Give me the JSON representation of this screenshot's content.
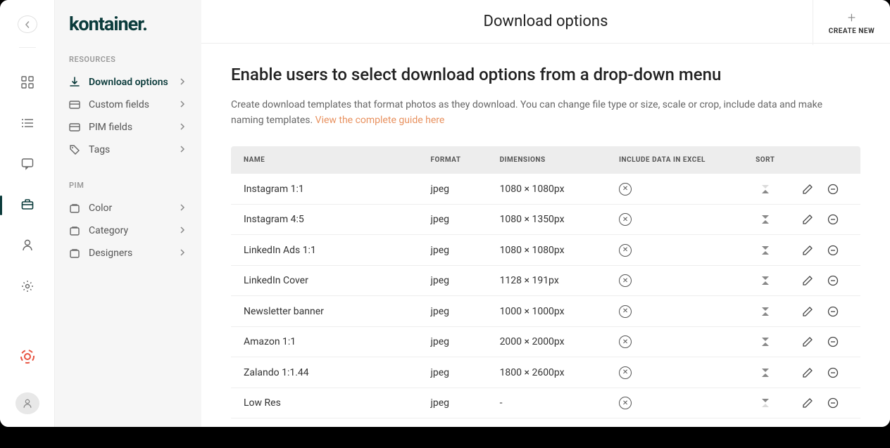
{
  "logo": "kontainer.",
  "page_title": "Download options",
  "create_new_label": "CREATE NEW",
  "heading": "Enable users to select download options from a drop-down menu",
  "description": "Create download templates that format photos as they download. You can change file type or size, scale or crop, include data and make naming templates. ",
  "description_link": "View the complete guide here",
  "sidebar": {
    "section1_label": "RESOURCES",
    "section2_label": "PIM",
    "items1": [
      {
        "label": "Download options",
        "icon": "download",
        "active": true
      },
      {
        "label": "Custom fields",
        "icon": "fields",
        "active": false
      },
      {
        "label": "PIM fields",
        "icon": "fields",
        "active": false
      },
      {
        "label": "Tags",
        "icon": "tag",
        "active": false
      }
    ],
    "items2": [
      {
        "label": "Color",
        "icon": "box",
        "active": false
      },
      {
        "label": "Category",
        "icon": "box",
        "active": false
      },
      {
        "label": "Designers",
        "icon": "box",
        "active": false
      }
    ]
  },
  "table": {
    "headers": {
      "name": "NAME",
      "format": "FORMAT",
      "dimensions": "DIMENSIONS",
      "excel": "INCLUDE DATA IN EXCEL",
      "sort": "SORT"
    },
    "rows": [
      {
        "name": "Instagram 1:1",
        "format": "jpeg",
        "dimensions": "1080 × 1080px",
        "first": true,
        "last": false
      },
      {
        "name": "Instagram 4:5",
        "format": "jpeg",
        "dimensions": "1080 × 1350px",
        "first": false,
        "last": false
      },
      {
        "name": "LinkedIn Ads 1:1",
        "format": "jpeg",
        "dimensions": "1080 × 1080px",
        "first": false,
        "last": false
      },
      {
        "name": "LinkedIn Cover",
        "format": "jpeg",
        "dimensions": "1128 × 191px",
        "first": false,
        "last": false
      },
      {
        "name": "Newsletter banner",
        "format": "jpeg",
        "dimensions": "1000 × 1000px",
        "first": false,
        "last": false
      },
      {
        "name": "Amazon 1:1",
        "format": "jpeg",
        "dimensions": "2000 × 2000px",
        "first": false,
        "last": false
      },
      {
        "name": "Zalando 1:1.44",
        "format": "jpeg",
        "dimensions": "1800 × 2600px",
        "first": false,
        "last": false
      },
      {
        "name": "Low Res",
        "format": "jpeg",
        "dimensions": "-",
        "first": false,
        "last": true
      }
    ]
  }
}
